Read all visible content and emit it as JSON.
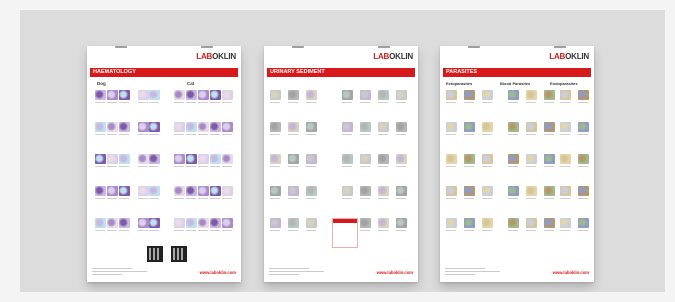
{
  "posters": [
    {
      "logo": {
        "first": "LAB",
        "rest": "OKLIN"
      },
      "title": "HAEMATOLOGY",
      "subheads": [
        "Dog",
        "Cat"
      ],
      "footer_url": "www.laboklin.com",
      "theme": [
        "#c9b8e2",
        "#a88acb",
        "#7d5aa8",
        "#dcd0ec",
        "#bfe0ef",
        "#e7dde6"
      ]
    },
    {
      "logo": {
        "first": "LAB",
        "rest": "OKLIN"
      },
      "title": "URINARY SEDIMENT",
      "subheads": [],
      "footer_url": "www.laboklin.com",
      "theme": [
        "#c9c9c9",
        "#b5b5b5",
        "#d8d2c0",
        "#a3a3a3",
        "#c3b6d6",
        "#b7c7c3"
      ]
    },
    {
      "logo": {
        "first": "LAB",
        "rest": "OKLIN"
      },
      "title": "PARASITES",
      "subheads": [
        "Ectoparasites",
        "Blood Parasites",
        "Endoparasites"
      ],
      "footer_url": "www.laboklin.com",
      "theme": [
        "#d8c59a",
        "#b79767",
        "#c9cfe3",
        "#8c9cc6",
        "#e2d6a8",
        "#9fb98d"
      ]
    }
  ]
}
